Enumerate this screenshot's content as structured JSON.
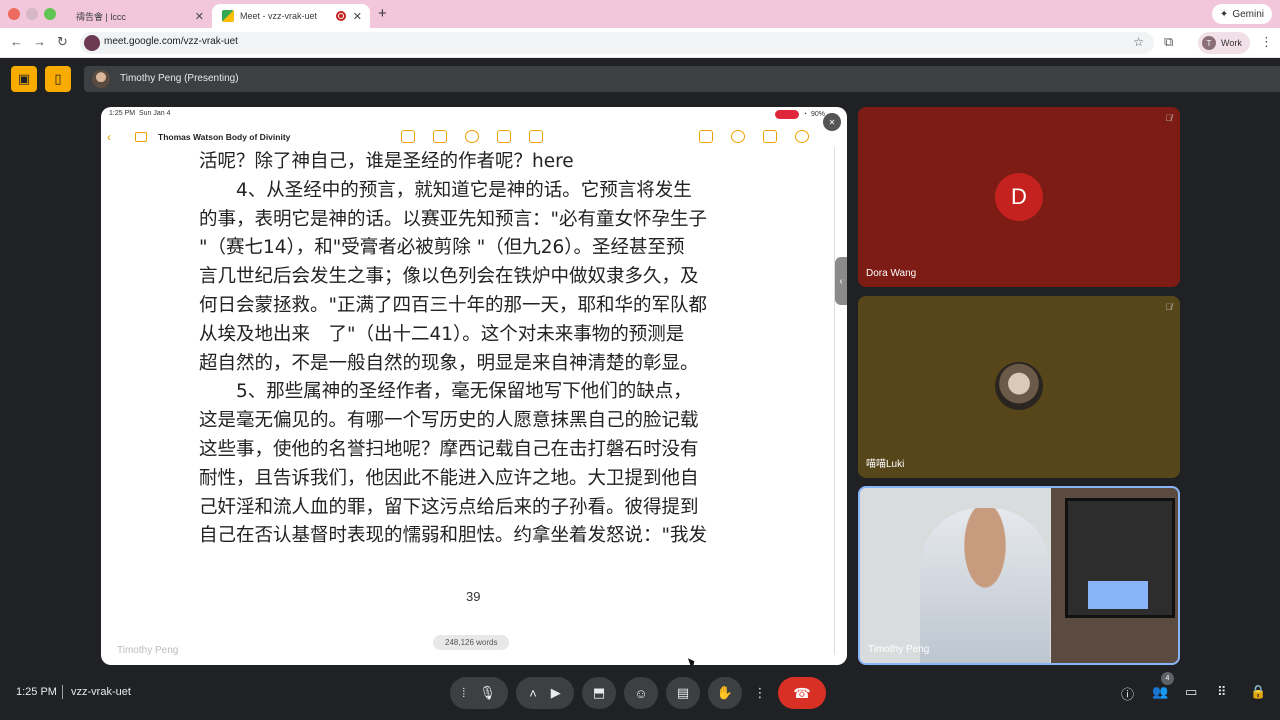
{
  "browser": {
    "tabs": [
      {
        "title": "禱告會 | lccc"
      },
      {
        "title": "Meet - vzz-vrak-uet"
      }
    ],
    "new_tab": "+",
    "url": "meet.google.com/vzz-vrak-uet",
    "gemini_label": "Gemini",
    "profile_initial": "T",
    "profile_label": "Work"
  },
  "presenter": {
    "label": "Timothy Peng (Presenting)"
  },
  "ipad": {
    "time": "1:25 PM",
    "date": "Sun Jan 4",
    "battery": "90%",
    "doc_title": "Thomas Watson Body of Divinity",
    "book_lines": [
      "活呢？除了神自己，谁是圣经的作者呢？here",
      "　　4、从圣经中的预言，就知道它是神的话。它预言将发生",
      "的事，表明它是神的话。以赛亚先知预言：\"必有童女怀孕生子",
      "\"（赛七14），和\"受膏者必被剪除 \"（但九26）。圣经甚至预",
      "言几世纪后会发生之事；像以色列会在铁炉中做奴隶多久，及",
      "何日会蒙拯救。\"正满了四百三十年的那一天，耶和华的军队都",
      "从埃及地出来　了\"（出十二41）。这个对未来事物的预测是",
      "超自然的，不是一般自然的现象，明显是来自神清楚的彰显。",
      "　　5、那些属神的圣经作者，毫无保留地写下他们的缺点，",
      "这是毫无偏见的。有哪一个写历史的人愿意抹黑自己的脸记载",
      "这些事，使他的名誉扫地呢？摩西记载自己在击打磐石时没有",
      "耐性，且告诉我们，他因此不能进入应许之地。大卫提到他自",
      "己奸淫和流人血的罪，留下这污点给后来的子孙看。彼得提到",
      "自己在否认基督时表现的懦弱和胆怯。约拿坐着发怒说：\"我发"
    ],
    "page_number": "39",
    "word_count": "248,126 words",
    "self_label": "Timothy Peng"
  },
  "participants": [
    {
      "name": "Dora Wang",
      "initial": "D",
      "muted": true
    },
    {
      "name": "喵喵Luki",
      "muted": true
    },
    {
      "name": "Timothy Peng",
      "muted": false
    }
  ],
  "bottom": {
    "time": "1:25 PM",
    "meeting_code": "vzz-vrak-uet",
    "people_count": "4"
  },
  "colors": {
    "tab_strip": "#f2c7dc",
    "meet_bg": "#202124",
    "accent_yellow": "#f9ab00",
    "end_call": "#d93025",
    "dora_tile": "#7c1c14",
    "luki_tile": "#56461a"
  }
}
